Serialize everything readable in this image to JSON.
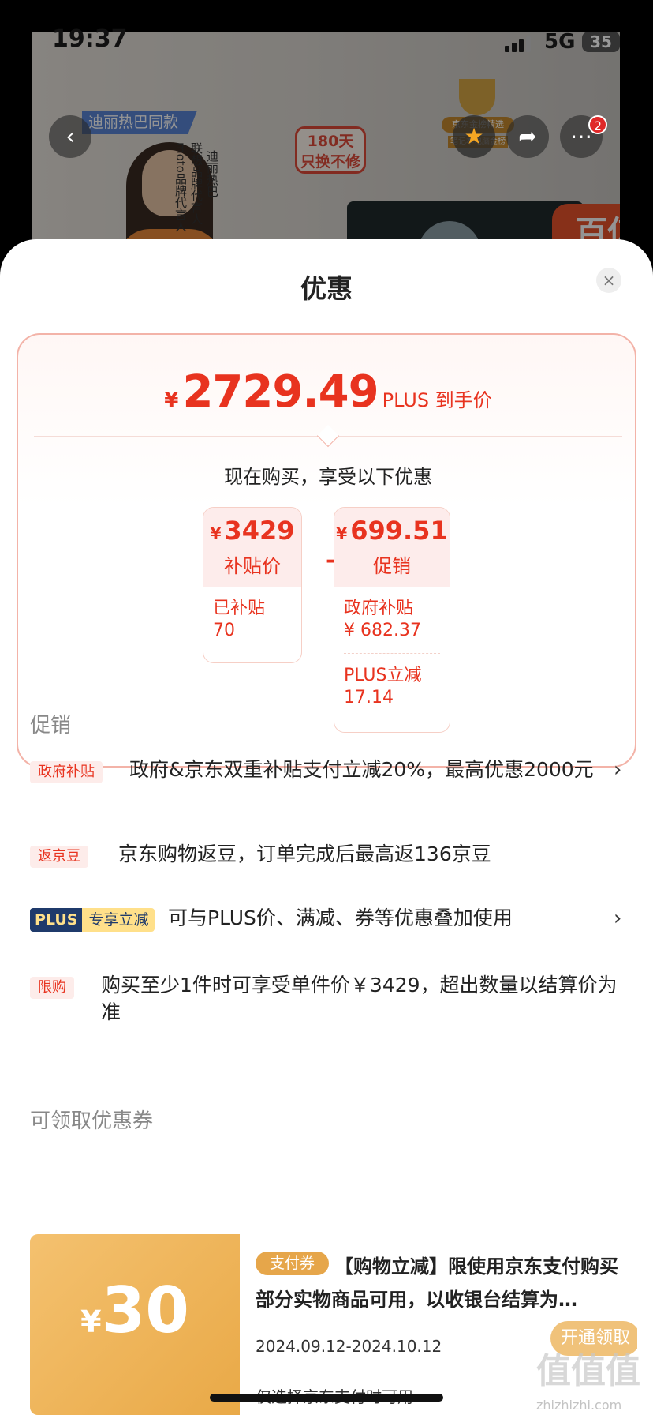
{
  "status": {
    "time": "19:37",
    "network": "5G",
    "battery": "35"
  },
  "product_banner": {
    "model_tag": "迪丽热巴同款",
    "spokesperson_lines": [
      "moto品牌代言人",
      "联想品牌代言人",
      "迪丽热巴"
    ],
    "badge_180": [
      "180天",
      "只换不修"
    ],
    "trophy_labels": [
      "京东金榜精选",
      "笔记本电脑金榜"
    ],
    "promo_badge": "百亿补贴",
    "notif_count": "2"
  },
  "sheet": {
    "title": "优惠",
    "close": "×"
  },
  "summary": {
    "price_symbol": "¥",
    "price": "2729.49",
    "price_suffix": "PLUS 到手价",
    "now_buy": "现在购买，享受以下优惠",
    "minus": "–",
    "left_box": {
      "symbol": "¥",
      "amount": "3429",
      "label": "补贴价",
      "detail_label": "已补贴",
      "detail_value": "70"
    },
    "right_box": {
      "symbol": "¥",
      "amount": "699.51",
      "label": "促销",
      "items": [
        {
          "label": "政府补贴",
          "value": "¥ 682.37"
        },
        {
          "label": "PLUS立减",
          "value": "17.14"
        }
      ]
    }
  },
  "promotions": {
    "title": "促销",
    "items": [
      {
        "tag": "政府补贴",
        "text": "政府&京东双重补贴支付立减20%，最高优惠2000元",
        "arrow": "›"
      },
      {
        "tag": "返京豆",
        "text": "京东购物返豆，订单完成后最高返136京豆"
      },
      {
        "tag_a": "PLUS",
        "tag_b": "专享立减",
        "text": "可与PLUS价、满减、券等优惠叠加使用",
        "arrow": "›"
      },
      {
        "tag": "限购",
        "text": "购买至少1件时可享受单件价￥3429，超出数量以结算价为准"
      }
    ]
  },
  "coupons": {
    "title": "可领取优惠券",
    "items": [
      {
        "symbol": "¥",
        "amount": "30",
        "tag": "支付券",
        "desc": "【购物立减】限使用京东支付购买部分实物商品可用，以收银台结算为…",
        "date": "2024.09.12-2024.10.12",
        "condition": "仅选择京东支付时可用",
        "button": "开通领取"
      }
    ]
  },
  "watermark": {
    "main": "值值值",
    "sub": "zhizhizhi.com"
  },
  "colors": {
    "accent": "#e8331f",
    "coupon_gold": "#e9a947",
    "plus_navy": "#1f3a6b"
  }
}
